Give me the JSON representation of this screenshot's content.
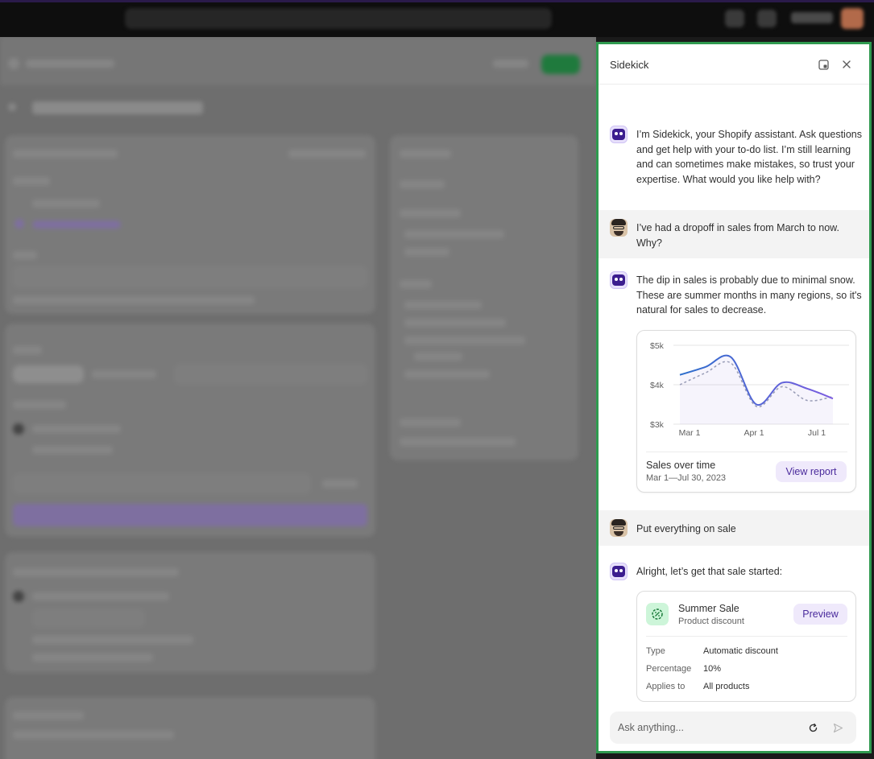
{
  "sidekick": {
    "title": "Sidekick",
    "header_icons": [
      "expand-panel-icon",
      "close-icon"
    ],
    "messages": [
      {
        "role": "assistant",
        "text": "I’m Sidekick, your Shopify assistant. Ask questions and get help with your to-do list. I’m still learning and can sometimes make mistakes, so trust your expertise. What would you like help with?"
      },
      {
        "role": "user",
        "text": "I’ve had a dropoff in sales from March to now. Why?"
      },
      {
        "role": "assistant",
        "text": "The dip in sales is probably due to minimal snow. These are summer months in many regions, so it's natural for sales to decrease."
      },
      {
        "role": "user",
        "text": "Put everything on sale"
      },
      {
        "role": "assistant",
        "text": "Alright, let’s get that sale started:"
      }
    ],
    "sales_card": {
      "title": "Sales over time",
      "subtitle": "Mar 1—Jul 30, 2023",
      "button": "View report"
    },
    "discount_card": {
      "name": "Summer Sale",
      "type_label": "Product discount",
      "button": "Preview",
      "rows": [
        {
          "key": "Type",
          "value": "Automatic discount"
        },
        {
          "key": "Percentage",
          "value": "10%"
        },
        {
          "key": "Applies to",
          "value": "All products"
        }
      ]
    },
    "composer": {
      "placeholder": "Ask anything...",
      "icons": [
        "refresh-icon",
        "send-icon"
      ]
    }
  },
  "chart_data": {
    "type": "line",
    "x_ticks": [
      "Mar 1",
      "Apr 1",
      "Jul 1"
    ],
    "y_ticks": [
      "$5k",
      "$4k",
      "$3k"
    ],
    "ylim": [
      3000,
      5000
    ],
    "series": [
      {
        "style": "solid",
        "color": "#2c6ecb",
        "values": [
          4250,
          4450,
          4700,
          3500,
          4050,
          3900,
          3650
        ]
      },
      {
        "style": "dashed",
        "color": "#9aa0b4",
        "values": [
          4000,
          4300,
          4550,
          3450,
          3950,
          3600,
          3700
        ]
      }
    ]
  }
}
